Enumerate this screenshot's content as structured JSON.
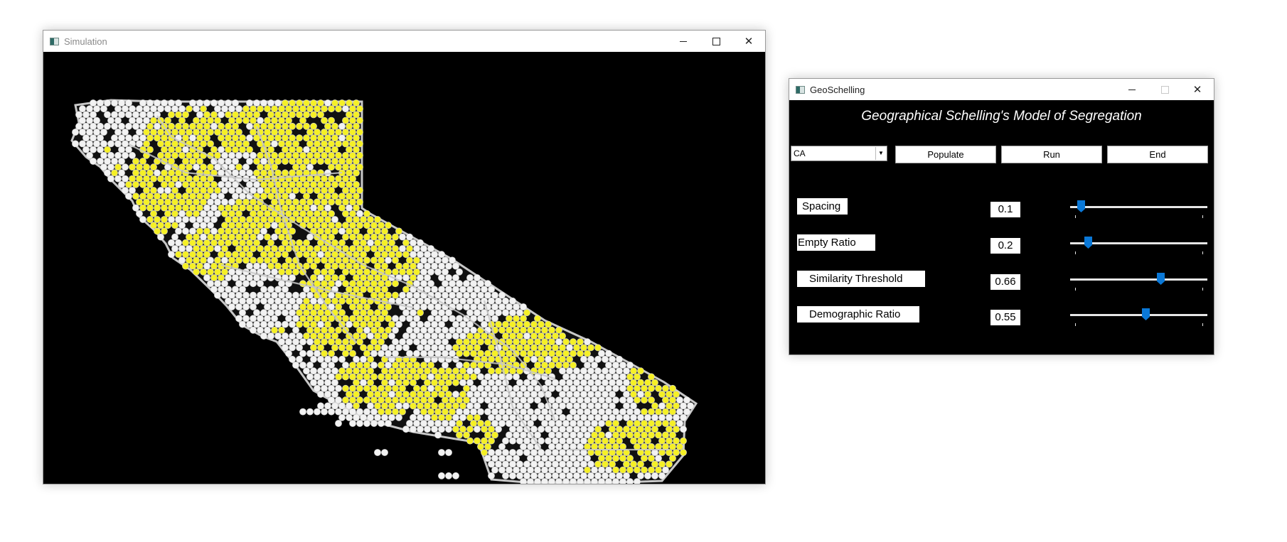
{
  "simulation_window": {
    "title": "Simulation",
    "controls": [
      "minimize",
      "maximize",
      "close"
    ],
    "map": {
      "region": "California",
      "background_color": "#000000",
      "agent_colors": {
        "group_a": "#f5f026",
        "group_b": "#f2f2f2"
      },
      "boundary_color": "#c8c8c8"
    }
  },
  "geo_window": {
    "title": "GeoSchelling",
    "heading": "Geographical Schelling's Model of Segregation",
    "state_select": {
      "value": "CA"
    },
    "buttons": {
      "populate": "Populate",
      "run": "Run",
      "end": "End"
    },
    "accent_color": "#0a78d7",
    "params": [
      {
        "label": "Spacing",
        "value": "0.1",
        "slider_fraction": 0.08
      },
      {
        "label": "Empty Ratio",
        "value": "0.2",
        "slider_fraction": 0.13
      },
      {
        "label": "Similarity Threshold",
        "value": "0.66",
        "slider_fraction": 0.66
      },
      {
        "label": "Demographic Ratio",
        "value": "0.55",
        "slider_fraction": 0.55
      }
    ]
  }
}
